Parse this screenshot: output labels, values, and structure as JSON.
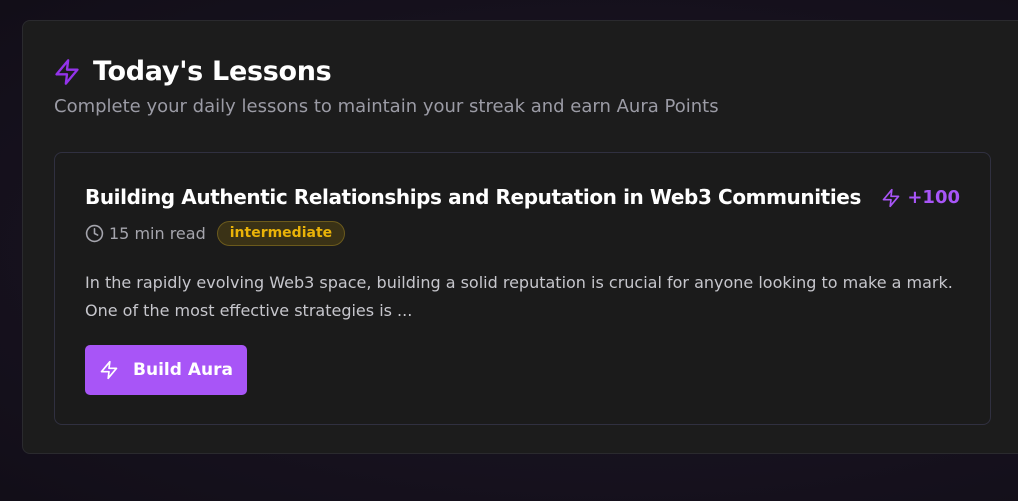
{
  "section": {
    "title": "Today's Lessons",
    "subtitle": "Complete your daily lessons to maintain your streak and earn Aura Points",
    "icon": "lightning-bolt-icon"
  },
  "lesson": {
    "title": "Building Authentic Relationships and Reputation in Web3 Communities",
    "points": "+100",
    "read_time": "15 min read",
    "level": "intermediate",
    "excerpt": "In the rapidly evolving Web3 space, building a solid reputation is crucial for anyone looking to make a mark. One of the most effective strategies is ...",
    "button_label": "Build Aura",
    "icons": {
      "points": "lightning-bolt-icon",
      "read_time": "clock-icon",
      "button": "lightning-bolt-icon"
    }
  },
  "colors": {
    "accent": "#a855f7",
    "badge_text": "#eab308",
    "panel_bg": "#1c1c1c"
  }
}
